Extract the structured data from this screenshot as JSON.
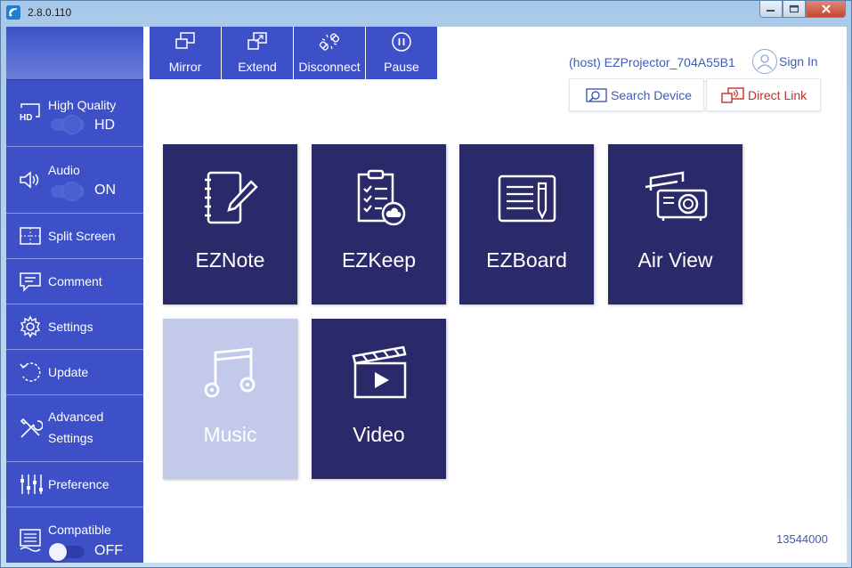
{
  "window": {
    "title": "2.8.0.110",
    "controls": {
      "minimize": "▭",
      "maximize": "□",
      "close": "✕"
    }
  },
  "sidebar": {
    "items": [
      {
        "label": "High Quality",
        "value": "HD",
        "icon": "hd-icon",
        "toggle": "on"
      },
      {
        "label": "Audio",
        "value": "ON",
        "icon": "speaker-icon",
        "toggle": "on"
      },
      {
        "label": "Split Screen",
        "icon": "split-screen-icon"
      },
      {
        "label": "Comment",
        "icon": "comment-icon"
      },
      {
        "label": "Settings",
        "icon": "gear-icon"
      },
      {
        "label": "Update",
        "icon": "update-icon"
      },
      {
        "label_line1": "Advanced",
        "label_line2": "Settings",
        "icon": "tools-icon"
      },
      {
        "label": "Preference",
        "icon": "sliders-icon"
      },
      {
        "label": "Compatible",
        "value": "OFF",
        "icon": "compatible-icon",
        "toggle": "off"
      }
    ]
  },
  "toolbar": {
    "buttons": [
      {
        "label": "Mirror",
        "icon": "mirror-icon"
      },
      {
        "label": "Extend",
        "icon": "extend-icon"
      },
      {
        "label": "Disconnect",
        "icon": "disconnect-icon"
      },
      {
        "label": "Pause",
        "icon": "pause-icon"
      }
    ]
  },
  "header": {
    "host_name": "(host) EZProjector_704A55B1",
    "sign_in": "Sign In",
    "search_device": "Search Device",
    "direct_link": "Direct Link"
  },
  "tiles": [
    {
      "label": "EZNote",
      "icon": "notebook-pen-icon"
    },
    {
      "label": "EZKeep",
      "icon": "clipboard-cloud-icon"
    },
    {
      "label": "EZBoard",
      "icon": "board-pencil-icon"
    },
    {
      "label": "Air View",
      "icon": "projector-icon"
    },
    {
      "label": "Music",
      "icon": "music-note-icon",
      "state": "disabled"
    },
    {
      "label": "Video",
      "icon": "clapperboard-icon"
    }
  ],
  "footer": {
    "build_number": "13544000"
  },
  "colors": {
    "sidebar": "#3d50c7",
    "tile": "#2a2a6a",
    "tile_disabled": "#c3c9e9",
    "accent_text": "#3e5bb8",
    "direct_link": "#c0302a"
  }
}
